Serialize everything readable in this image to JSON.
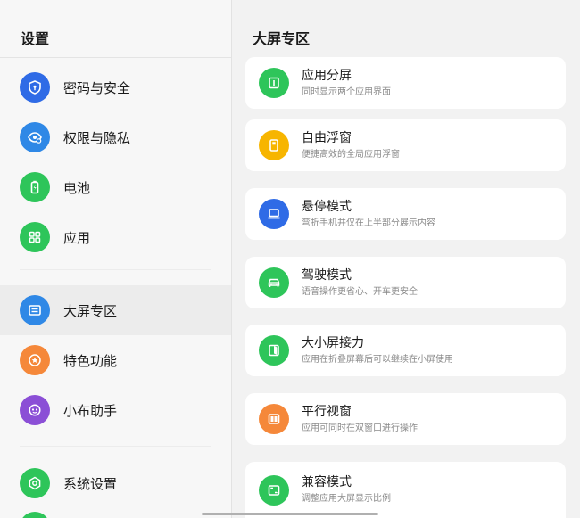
{
  "sidebar": {
    "title": "设置",
    "items": [
      {
        "label": "密码与安全",
        "color": "#2f6be6",
        "icon": "shield-icon"
      },
      {
        "label": "权限与隐私",
        "color": "#2f88e6",
        "icon": "privacy-eye-icon"
      },
      {
        "label": "电池",
        "color": "#2ec55a",
        "icon": "battery-icon"
      },
      {
        "label": "应用",
        "color": "#2ec55a",
        "icon": "apps-grid-icon"
      },
      {
        "label": "大屏专区",
        "color": "#2f88e6",
        "icon": "large-screen-icon",
        "active": true
      },
      {
        "label": "特色功能",
        "color": "#f5883a",
        "icon": "star-badge-icon"
      },
      {
        "label": "小布助手",
        "color": "#8b4fd6",
        "icon": "assistant-icon"
      },
      {
        "label": "系统设置",
        "color": "#2ec55a",
        "icon": "system-gear-icon"
      }
    ]
  },
  "main": {
    "title": "大屏专区",
    "cards": [
      {
        "title": "应用分屏",
        "subtitle": "同时显示两个应用界面",
        "color": "#2ec55a",
        "icon": "split-screen-icon"
      },
      {
        "title": "自由浮窗",
        "subtitle": "便捷高效的全局应用浮窗",
        "color": "#f7b500",
        "icon": "floating-window-icon"
      },
      {
        "title": "悬停模式",
        "subtitle": "弯折手机并仅在上半部分展示内容",
        "color": "#2f6be6",
        "icon": "laptop-icon"
      },
      {
        "title": "驾驶模式",
        "subtitle": "语音操作更省心、开车更安全",
        "color": "#2ec55a",
        "icon": "car-icon"
      },
      {
        "title": "大小屏接力",
        "subtitle": "应用在折叠屏幕后可以继续在小屏使用",
        "color": "#2ec55a",
        "icon": "fold-relay-icon"
      },
      {
        "title": "平行视窗",
        "subtitle": "应用可同时在双窗口进行操作",
        "color": "#f5883a",
        "icon": "parallel-window-icon"
      },
      {
        "title": "兼容模式",
        "subtitle": "调整应用大屏显示比例",
        "color": "#2ec55a",
        "icon": "compat-ratio-icon"
      }
    ]
  }
}
